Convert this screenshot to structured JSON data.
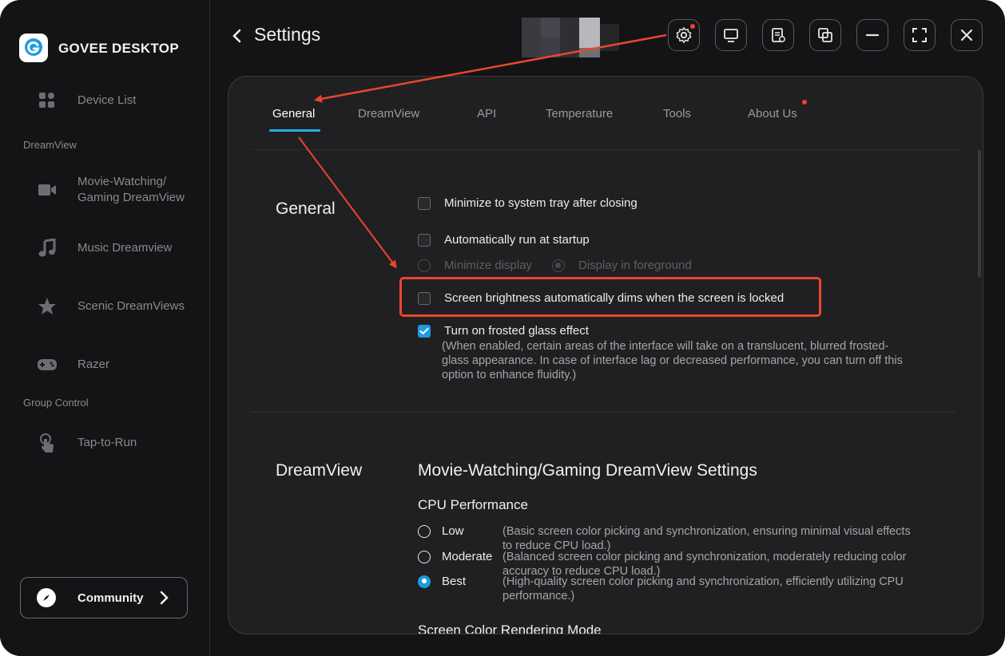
{
  "app": {
    "name": "GOVEE DESKTOP"
  },
  "sidebar": {
    "device_list": "Device List",
    "group_dreamview": "DreamView",
    "movie_gaming": "Movie-Watching/\nGaming DreamView",
    "music": "Music Dreamview",
    "scenic": "Scenic DreamViews",
    "razer": "Razer",
    "group_control": "Group Control",
    "tap_to_run": "Tap-to-Run",
    "community": "Community"
  },
  "header": {
    "title": "Settings"
  },
  "toolbar": {
    "icons": [
      "settings-icon",
      "monitor-icon",
      "notes-icon",
      "screenshot-icon",
      "minimize-icon",
      "fullscreen-icon",
      "close-icon"
    ]
  },
  "tabs": [
    {
      "label": "General",
      "active": true
    },
    {
      "label": "DreamView",
      "active": false
    },
    {
      "label": "API",
      "active": false
    },
    {
      "label": "Temperature",
      "active": false
    },
    {
      "label": "Tools",
      "active": false
    },
    {
      "label": "About Us",
      "active": false
    }
  ],
  "general": {
    "title": "General",
    "minimize_tray": "Minimize to system tray after closing",
    "auto_run": "Automatically run at startup",
    "minimize_display": "Minimize display",
    "display_foreground": "Display in foreground",
    "brightness_dim": "Screen brightness automatically dims when the screen is locked",
    "frosted_glass": "Turn on frosted glass effect",
    "frosted_desc_1": "(When enabled, certain areas of the interface will take on a translucent, blurred frosted-",
    "frosted_desc_2": "glass appearance. In case of interface lag or decreased performance, you can turn off this",
    "frosted_desc_3": "option to enhance fluidity.)"
  },
  "dreamview": {
    "title": "DreamView",
    "settings_title": "Movie-Watching/Gaming DreamView Settings",
    "cpu_title": "CPU Performance",
    "low": "Low",
    "low_desc_1": "(Basic screen color picking and synchronization, ensuring minimal visual effects",
    "low_desc_2": "to reduce CPU load.)",
    "moderate": "Moderate",
    "moderate_desc_1": "(Balanced screen color picking and synchronization, moderately reducing color",
    "moderate_desc_2": "accuracy to reduce CPU load.)",
    "best": "Best",
    "best_desc_1": "(High-quality screen color picking and synchronization, efficiently utilizing CPU",
    "best_desc_2": "performance.)",
    "rendering_title": "Screen Color Rendering Mode"
  },
  "colors": {
    "accent": "#1e9be0",
    "annotation": "#e8472e",
    "notification": "#ff3b30"
  }
}
